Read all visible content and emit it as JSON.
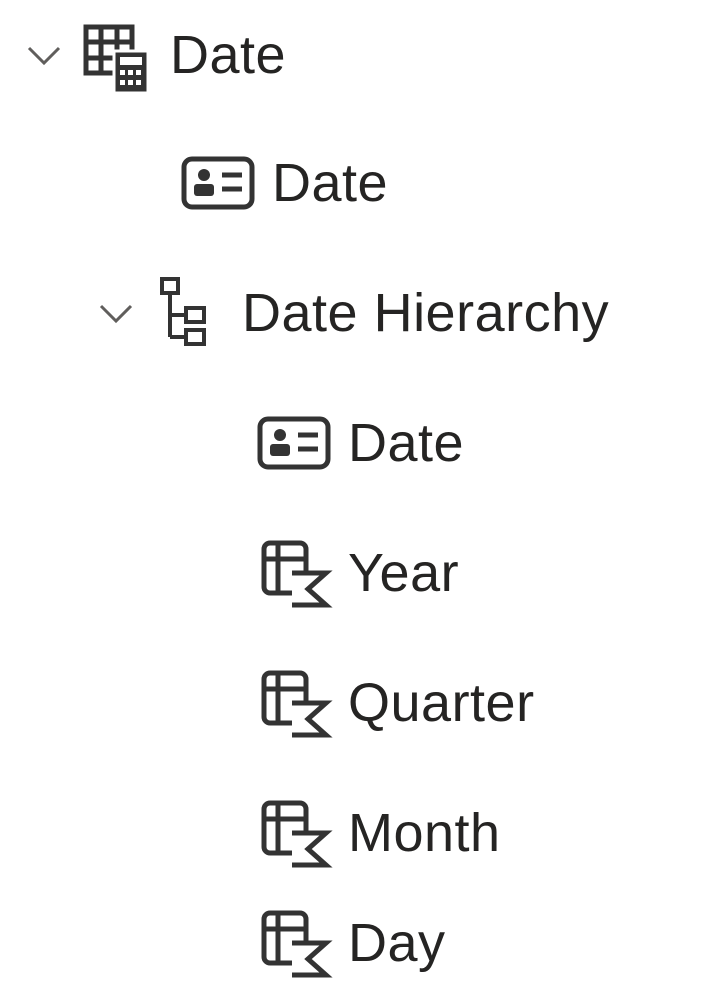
{
  "tree": {
    "table": {
      "label": "Date",
      "icon": "calculated-table-icon",
      "expanded": true
    },
    "column_date": {
      "label": "Date",
      "icon": "column-card-icon"
    },
    "hierarchy": {
      "label": "Date Hierarchy",
      "icon": "hierarchy-icon",
      "expanded": true,
      "levels": [
        {
          "label": "Date",
          "icon": "column-card-icon"
        },
        {
          "label": "Year",
          "icon": "calculated-column-icon"
        },
        {
          "label": "Quarter",
          "icon": "calculated-column-icon"
        },
        {
          "label": "Month",
          "icon": "calculated-column-icon"
        },
        {
          "label": "Day",
          "icon": "calculated-column-icon"
        }
      ]
    }
  },
  "colors": {
    "text": "#252423",
    "icon": "#333333",
    "chevron": "#605e5c",
    "background": "#ffffff"
  }
}
